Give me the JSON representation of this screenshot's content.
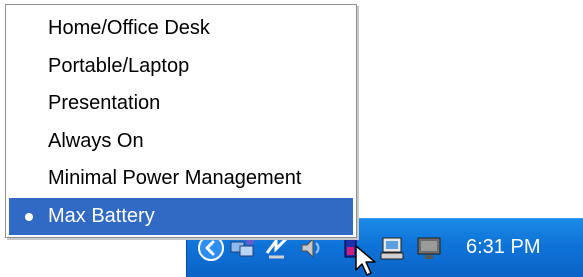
{
  "menu": {
    "items": [
      {
        "label": "Home/Office Desk",
        "selected": false
      },
      {
        "label": "Portable/Laptop",
        "selected": false
      },
      {
        "label": "Presentation",
        "selected": false
      },
      {
        "label": "Always On",
        "selected": false
      },
      {
        "label": "Minimal Power Management",
        "selected": false
      },
      {
        "label": "Max Battery",
        "selected": true
      }
    ]
  },
  "taskbar": {
    "clock": "6:31 PM",
    "icons": [
      "chevron-left-icon",
      "network-icon",
      "wireless-icon",
      "speaker-icon",
      "power-icon",
      "computer-icon",
      "monitor-icon"
    ]
  },
  "colors": {
    "selection": "#316ac5",
    "taskbar": "#0f73d8",
    "menu_border": "#8f8f8f"
  }
}
